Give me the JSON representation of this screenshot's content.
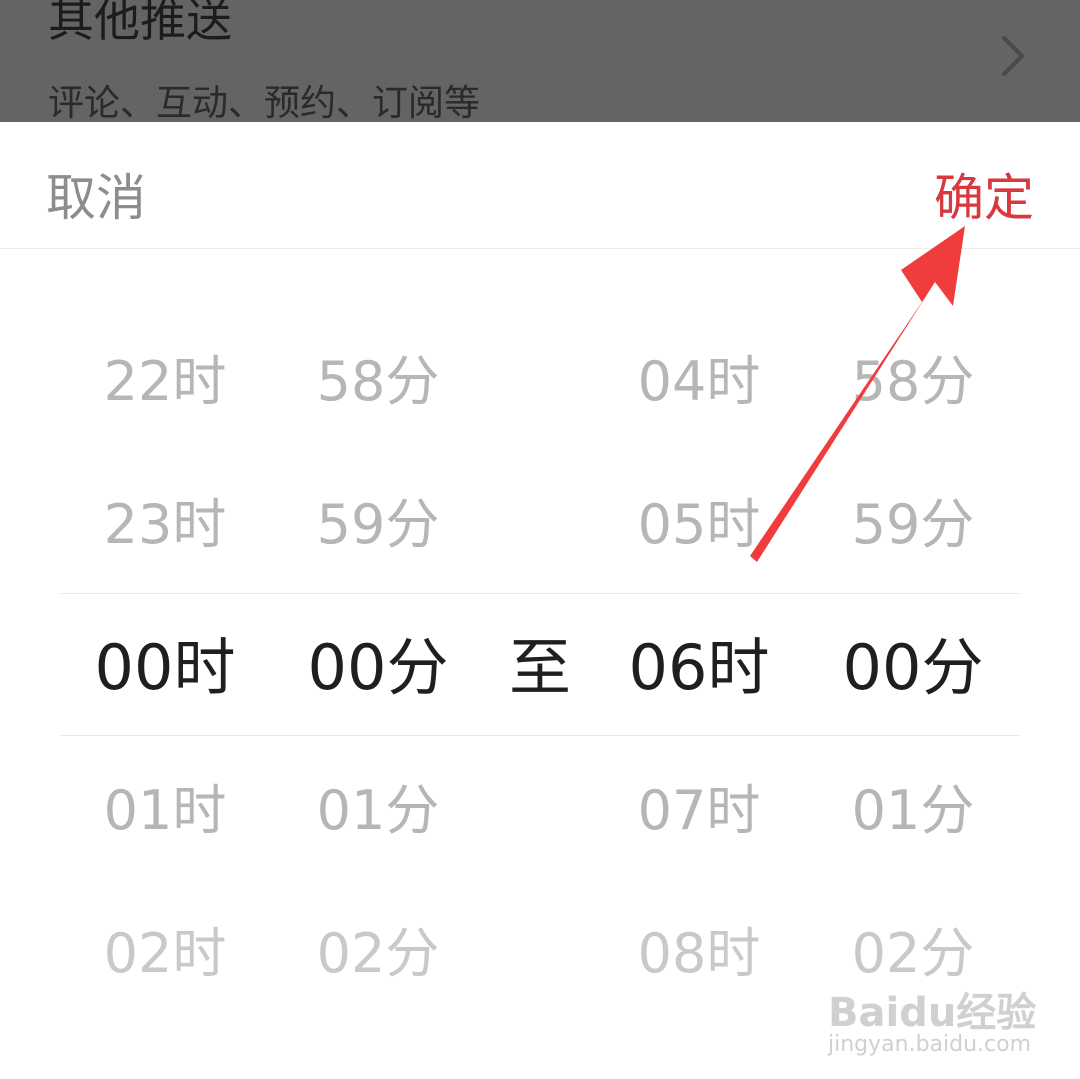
{
  "background_row": {
    "title": "其他推送",
    "subtitle": "评论、互动、预约、订阅等",
    "chevron_icon": "chevron-right-icon"
  },
  "header": {
    "cancel_label": "取消",
    "confirm_label": "确定",
    "confirm_color": "#d8383e"
  },
  "picker": {
    "start_hour": [
      "22时",
      "23时",
      "00时",
      "01时",
      "02时"
    ],
    "start_minute": [
      "58分",
      "59分",
      "00分",
      "01分",
      "02分"
    ],
    "separator": "至",
    "end_hour": [
      "04时",
      "05时",
      "06时",
      "07时",
      "08时"
    ],
    "end_minute": [
      "58分",
      "59分",
      "00分",
      "01分",
      "02分"
    ],
    "selected_index": 2
  },
  "annotation": {
    "arrow_color": "#f03c3c",
    "icon": "annotation-arrow-icon"
  },
  "watermark": {
    "brand": "Baidu经验",
    "url": "jingyan.baidu.com"
  }
}
